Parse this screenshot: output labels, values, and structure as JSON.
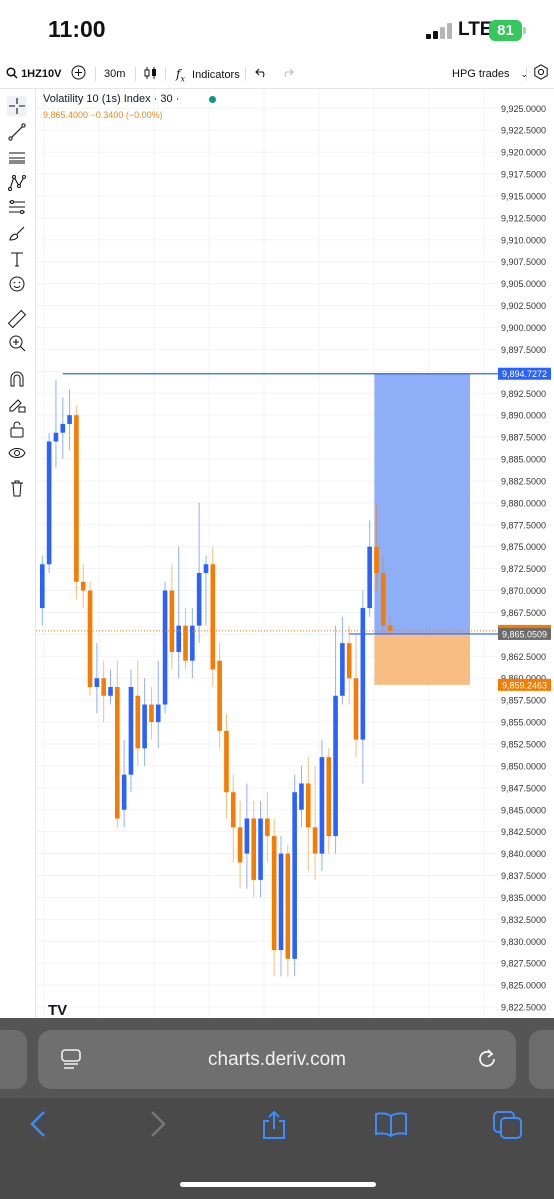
{
  "status_bar": {
    "time": "11:00",
    "network": "LTE",
    "battery": "81"
  },
  "toolbar": {
    "symbol": "1HZ10V",
    "timeframe": "30m",
    "indicators_label": "Indicators",
    "trades_label": "HPG trades"
  },
  "left_tools": [
    "crosshair-icon",
    "trend-line-icon",
    "horizontal-lines-icon",
    "pattern-icon",
    "fib-icon",
    "brush-icon",
    "text-icon",
    "emoji-icon",
    "ruler-icon",
    "zoom-in-icon",
    "magnet-icon",
    "lock-drawing-icon",
    "lock-icon",
    "eye-icon",
    "trash-icon"
  ],
  "chart": {
    "title": "Volatility 10 (1s) Index · 30 ·",
    "legend_values": "9,865.4000  −0.3400 (−0.00%)",
    "colors": {
      "up": "#2962ff",
      "down": "#f57c00",
      "target": "#7ba0f7",
      "stop": "#f7b26b"
    },
    "price_labels": [
      {
        "text": "9,894.7272",
        "value": 9894.7272,
        "bg": "#2962ff",
        "fg": "#ffffff"
      },
      {
        "text": "9,865.4000",
        "value": 9865.4,
        "bg": "#f57c00",
        "fg": "#ffffff"
      },
      {
        "text": "9,865.0509",
        "value": 9865.0509,
        "bg": "#6b6b6b",
        "fg": "#ffffff"
      },
      {
        "text": "9,859.2463",
        "value": 9859.2463,
        "bg": "#f57c00",
        "fg": "#ffffff"
      }
    ],
    "watermark": "TV"
  },
  "chart_data": {
    "type": "candlestick",
    "ylim": [
      9821.25,
      9927.2
    ],
    "yticks": [
      "9,925.0000",
      "9,922.5000",
      "9,920.0000",
      "9,917.5000",
      "9,915.0000",
      "9,912.5000",
      "9,910.0000",
      "9,907.5000",
      "9,905.0000",
      "9,902.5000",
      "9,900.0000",
      "9,897.5000",
      "9,895.0000",
      "9,892.5000",
      "9,890.0000",
      "9,887.5000",
      "9,885.0000",
      "9,882.5000",
      "9,880.0000",
      "9,877.5000",
      "9,875.0000",
      "9,872.5000",
      "9,870.0000",
      "9,867.5000",
      "9,865.0000",
      "9,862.5000",
      "9,860.0000",
      "9,857.5000",
      "9,855.0000",
      "9,852.5000",
      "9,850.0000",
      "9,847.5000",
      "9,845.0000",
      "9,842.5000",
      "9,840.0000",
      "9,837.5000",
      "9,835.0000",
      "9,832.5000",
      "9,830.0000",
      "9,827.5000",
      "9,825.0000",
      "9,822.5000"
    ],
    "candles": [
      [
        9868,
        9873,
        9866,
        9874
      ],
      [
        9873,
        9887,
        9872,
        9888
      ],
      [
        9887,
        9888,
        9884,
        9894
      ],
      [
        9888,
        9889,
        9885,
        9892
      ],
      [
        9889,
        9890,
        9886,
        9893
      ],
      [
        9890,
        9871,
        9869,
        9891
      ],
      [
        9871,
        9870,
        9868,
        9873
      ],
      [
        9870,
        9859,
        9858,
        9871
      ],
      [
        9859,
        9860,
        9856,
        9864
      ],
      [
        9860,
        9858,
        9855,
        9862
      ],
      [
        9858,
        9859,
        9857,
        9861
      ],
      [
        9859,
        9844,
        9843,
        9862
      ],
      [
        9845,
        9849,
        9843,
        9853
      ],
      [
        9849,
        9859,
        9847,
        9861
      ],
      [
        9858,
        9852,
        9850,
        9862
      ],
      [
        9852,
        9857,
        9850,
        9860
      ],
      [
        9857,
        9855,
        9853,
        9859
      ],
      [
        9855,
        9857,
        9852,
        9862
      ],
      [
        9857,
        9870,
        9856,
        9871
      ],
      [
        9870,
        9863,
        9861,
        9873
      ],
      [
        9863,
        9866,
        9860,
        9875
      ],
      [
        9866,
        9862,
        9861,
        9868
      ],
      [
        9862,
        9866,
        9860,
        9868
      ],
      [
        9866,
        9872,
        9864,
        9880
      ],
      [
        9872,
        9873,
        9866,
        9874
      ],
      [
        9873,
        9861,
        9859,
        9875
      ],
      [
        9862,
        9854,
        9852,
        9864
      ],
      [
        9854,
        9847,
        9844,
        9856
      ],
      [
        9847,
        9843,
        9839,
        9849
      ],
      [
        9843,
        9839,
        9836,
        9846
      ],
      [
        9840,
        9844,
        9836,
        9848
      ],
      [
        9844,
        9837,
        9835,
        9846
      ],
      [
        9837,
        9844,
        9835,
        9846
      ],
      [
        9844,
        9842,
        9839,
        9847
      ],
      [
        9842,
        9829,
        9826,
        9844
      ],
      [
        9829,
        9840,
        9826,
        9842
      ],
      [
        9840,
        9828,
        9826,
        9841
      ],
      [
        9828,
        9847,
        9826,
        9849
      ],
      [
        9845,
        9848,
        9843,
        9850
      ],
      [
        9848,
        9843,
        9838,
        9851
      ],
      [
        9843,
        9840,
        9837,
        9850
      ],
      [
        9840,
        9851,
        9838,
        9853
      ],
      [
        9851,
        9842,
        9840,
        9852
      ],
      [
        9842,
        9858,
        9840,
        9866
      ],
      [
        9858,
        9864,
        9857,
        9867
      ],
      [
        9864,
        9860,
        9857,
        9866
      ],
      [
        9860,
        9853,
        9851,
        9865
      ],
      [
        9853,
        9868,
        9848,
        9870
      ],
      [
        9868,
        9875,
        9867,
        9878
      ],
      [
        9875,
        9872,
        9870,
        9880
      ],
      [
        9872,
        9866,
        9865,
        9874
      ],
      [
        9866,
        9865.4,
        9865,
        9867
      ]
    ]
  }
}
